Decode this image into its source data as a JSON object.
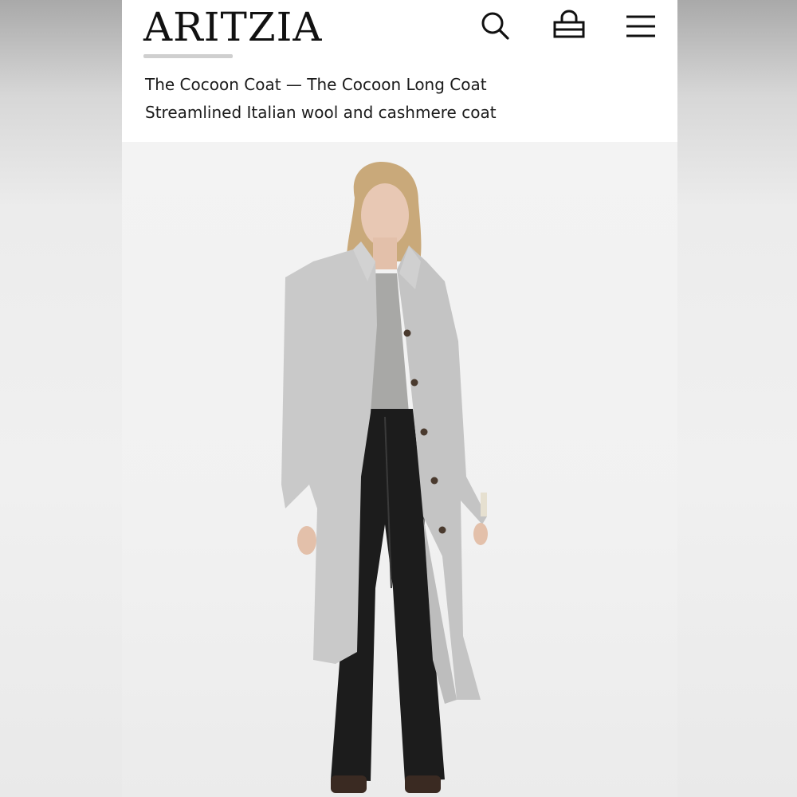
{
  "header": {
    "logo": "ARITZIA",
    "icons": {
      "search": "search-icon",
      "bag": "shopping-bag-icon",
      "menu": "hamburger-menu-icon"
    }
  },
  "product": {
    "title": "The Cocoon Coat — The Cocoon Long Coat",
    "subtitle": "Streamlined Italian wool and cashmere coat"
  },
  "colors": {
    "coat": "#c9c9c9",
    "pants": "#1c1c1c",
    "background": "#f2f2f2",
    "text": "#1b1b1b"
  }
}
